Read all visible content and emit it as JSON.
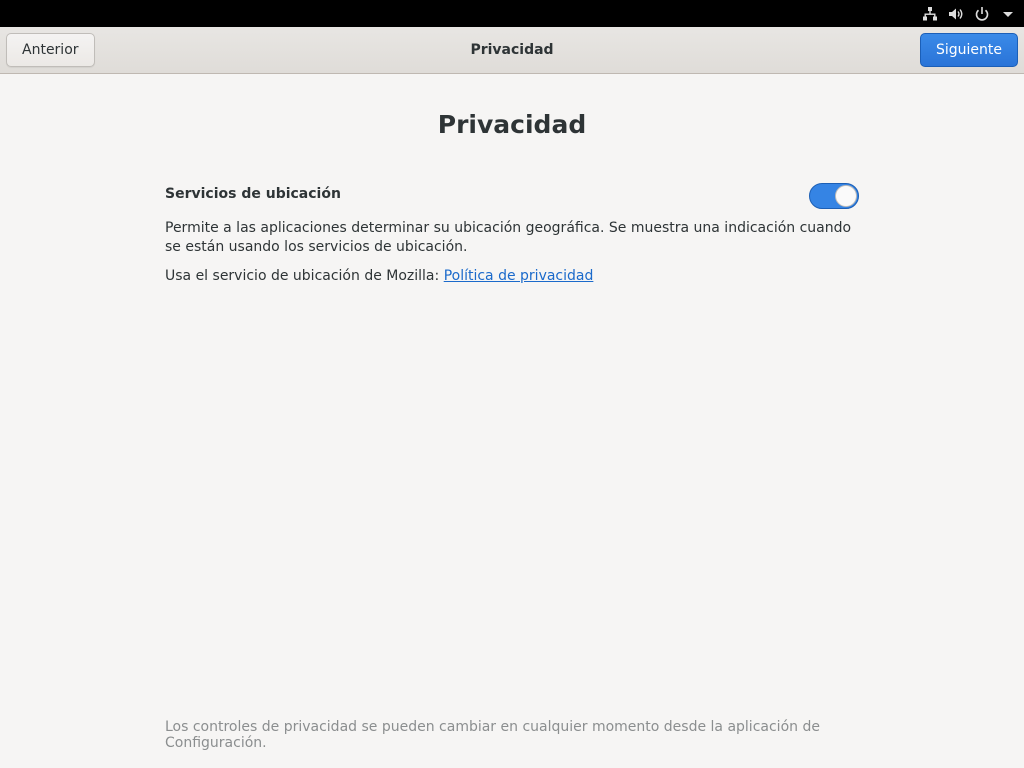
{
  "system_tray": {
    "icons": [
      "network-icon",
      "volume-icon",
      "power-icon",
      "dropdown-arrow-icon"
    ]
  },
  "header": {
    "back_label": "Anterior",
    "title": "Privacidad",
    "next_label": "Siguiente"
  },
  "page": {
    "title": "Privacidad",
    "location_services": {
      "label": "Servicios de ubicación",
      "enabled": true,
      "description": "Permite a las aplicaciones determinar su ubicación geográfica. Se muestra una indicación cuando se están usando los servicios de ubicación.",
      "mozilla_text": "Usa el servicio de ubicación de Mozilla: ",
      "privacy_link": "Política de privacidad"
    },
    "footer": "Los controles de privacidad se pueden cambiar en cualquier momento desde la aplicación de Configuración."
  },
  "colors": {
    "accent": "#3584e4",
    "link": "#1b6acb",
    "background": "#f6f5f4"
  }
}
